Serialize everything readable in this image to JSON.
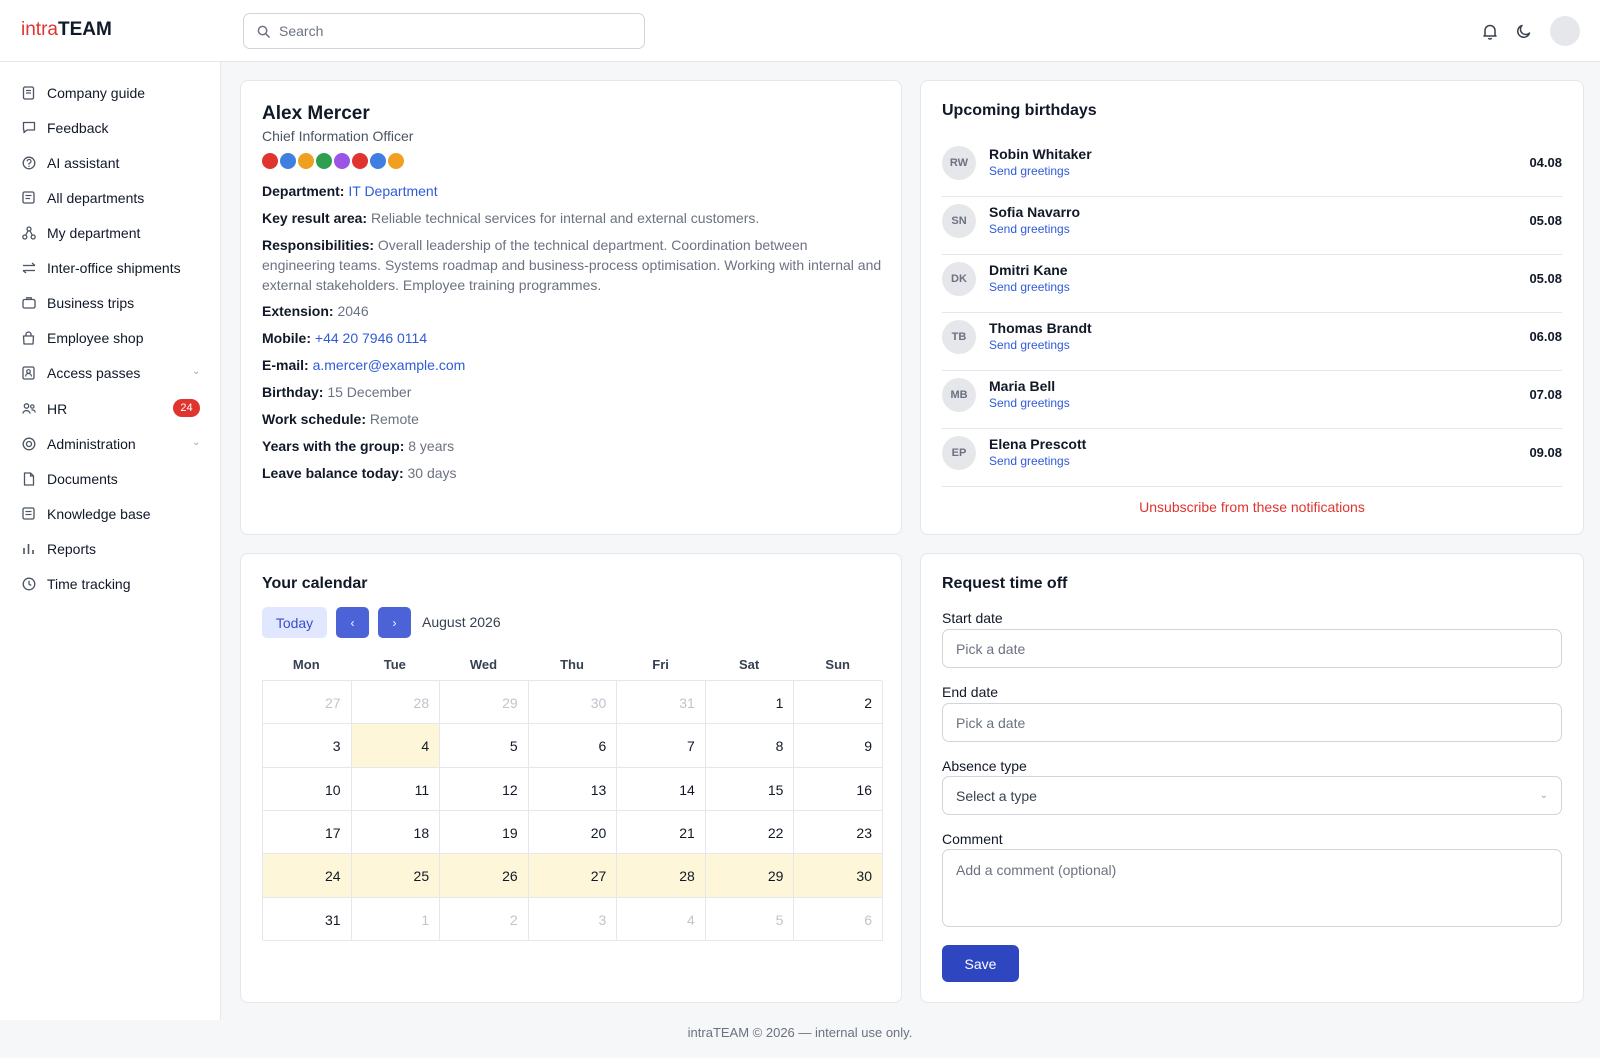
{
  "header": {
    "logo_prefix": "intra",
    "logo_suffix": "TEAM",
    "search_placeholder": "Search"
  },
  "sidebar": {
    "items": [
      {
        "label": "Company guide",
        "icon": "book-icon"
      },
      {
        "label": "Feedback",
        "icon": "chat-icon"
      },
      {
        "label": "AI assistant",
        "icon": "help-circle-icon"
      },
      {
        "label": "All departments",
        "icon": "list-icon"
      },
      {
        "label": "My department",
        "icon": "org-icon"
      },
      {
        "label": "Inter-office shipments",
        "icon": "transfer-icon"
      },
      {
        "label": "Business trips",
        "icon": "briefcase-icon"
      },
      {
        "label": "Employee shop",
        "icon": "bag-icon"
      },
      {
        "label": "Access passes",
        "icon": "badge-icon"
      },
      {
        "label": "HR",
        "icon": "people-icon",
        "badge": "24"
      },
      {
        "label": "Administration",
        "icon": "target-icon"
      },
      {
        "label": "Documents",
        "icon": "document-icon"
      },
      {
        "label": "Knowledge base",
        "icon": "notes-icon"
      },
      {
        "label": "Reports",
        "icon": "bar-chart-icon"
      },
      {
        "label": "Time tracking",
        "icon": "clock-icon"
      }
    ]
  },
  "profile": {
    "name": "Alex Mercer",
    "role": "Chief Information Officer",
    "dot_colors": [
      "#e0342f",
      "#3f7fe0",
      "#f0a020",
      "#2e9e4f",
      "#9a55e6",
      "#e0342f",
      "#3f7fe0",
      "#f0a020"
    ],
    "department_label": "Department:",
    "department_value": "IT Department",
    "kra_label": "Key result area:",
    "kra_value": "Reliable technical services for internal and external customers.",
    "resp_label": "Responsibilities:",
    "resp_value": "Overall leadership of the technical department. Coordination between engineering teams. Systems roadmap and business-process optimisation. Working with internal and external stakeholders. Employee training programmes.",
    "extension_label": "Extension:",
    "extension_value": "2046",
    "mobile_label": "Mobile:",
    "mobile_value": "+44 20 7946 0114",
    "email_label": "E-mail:",
    "email_value": "a.mercer@example.com",
    "birthday_label": "Birthday:",
    "birthday_value": "15 December",
    "schedule_label": "Work schedule:",
    "schedule_value": "Remote",
    "years_label": "Years with the group:",
    "years_value": "8 years",
    "leave_label": "Leave balance today:",
    "leave_value": "30 days"
  },
  "birthdays": {
    "title": "Upcoming birthdays",
    "link_label": "Send greetings",
    "people": [
      {
        "initials": "RW",
        "name": "Robin Whitaker",
        "date": "04.08"
      },
      {
        "initials": "SN",
        "name": "Sofia Navarro",
        "date": "05.08"
      },
      {
        "initials": "DK",
        "name": "Dmitri Kane",
        "date": "05.08"
      },
      {
        "initials": "TB",
        "name": "Thomas Brandt",
        "date": "06.08"
      },
      {
        "initials": "MB",
        "name": "Maria Bell",
        "date": "07.08"
      },
      {
        "initials": "EP",
        "name": "Elena Prescott",
        "date": "09.08"
      }
    ],
    "unsubscribe": "Unsubscribe from these notifications"
  },
  "calendar": {
    "title": "Your calendar",
    "today_label": "Today",
    "prev_label": "‹",
    "next_label": "›",
    "month": "August 2026",
    "weekdays": [
      "Mon",
      "Tue",
      "Wed",
      "Thu",
      "Fri",
      "Sat",
      "Sun"
    ],
    "weeks": [
      [
        {
          "d": "27",
          "m": true
        },
        {
          "d": "28",
          "m": true
        },
        {
          "d": "29",
          "m": true
        },
        {
          "d": "30",
          "m": true
        },
        {
          "d": "31",
          "m": true
        },
        {
          "d": "1"
        },
        {
          "d": "2"
        }
      ],
      [
        {
          "d": "3"
        },
        {
          "d": "4",
          "h": true
        },
        {
          "d": "5"
        },
        {
          "d": "6"
        },
        {
          "d": "7"
        },
        {
          "d": "8"
        },
        {
          "d": "9"
        }
      ],
      [
        {
          "d": "10"
        },
        {
          "d": "11"
        },
        {
          "d": "12"
        },
        {
          "d": "13"
        },
        {
          "d": "14"
        },
        {
          "d": "15"
        },
        {
          "d": "16"
        }
      ],
      [
        {
          "d": "17"
        },
        {
          "d": "18"
        },
        {
          "d": "19"
        },
        {
          "d": "20"
        },
        {
          "d": "21"
        },
        {
          "d": "22"
        },
        {
          "d": "23"
        }
      ],
      [
        {
          "d": "24",
          "h": true
        },
        {
          "d": "25",
          "h": true
        },
        {
          "d": "26",
          "h": true
        },
        {
          "d": "27",
          "h": true
        },
        {
          "d": "28",
          "h": true
        },
        {
          "d": "29",
          "h": true
        },
        {
          "d": "30",
          "h": true
        }
      ],
      [
        {
          "d": "31"
        },
        {
          "d": "1",
          "m": true
        },
        {
          "d": "2",
          "m": true
        },
        {
          "d": "3",
          "m": true
        },
        {
          "d": "4",
          "m": true
        },
        {
          "d": "5",
          "m": true
        },
        {
          "d": "6",
          "m": true
        }
      ]
    ],
    "highlight_color": "#fdf6d8"
  },
  "request": {
    "title": "Request time off",
    "start_label": "Start date",
    "start_placeholder": "Pick a date",
    "end_label": "End date",
    "end_placeholder": "Pick a date",
    "type_label": "Absence type",
    "type_value": "Select a type",
    "comment_label": "Comment",
    "comment_placeholder": "Add a comment (optional)",
    "save_label": "Save"
  },
  "footer": {
    "text": "intraTEAM © 2026 — internal use only."
  },
  "colors": {
    "brand": "#e0342f",
    "link": "#2f5bd8",
    "primary_button": "#2f46c1"
  }
}
